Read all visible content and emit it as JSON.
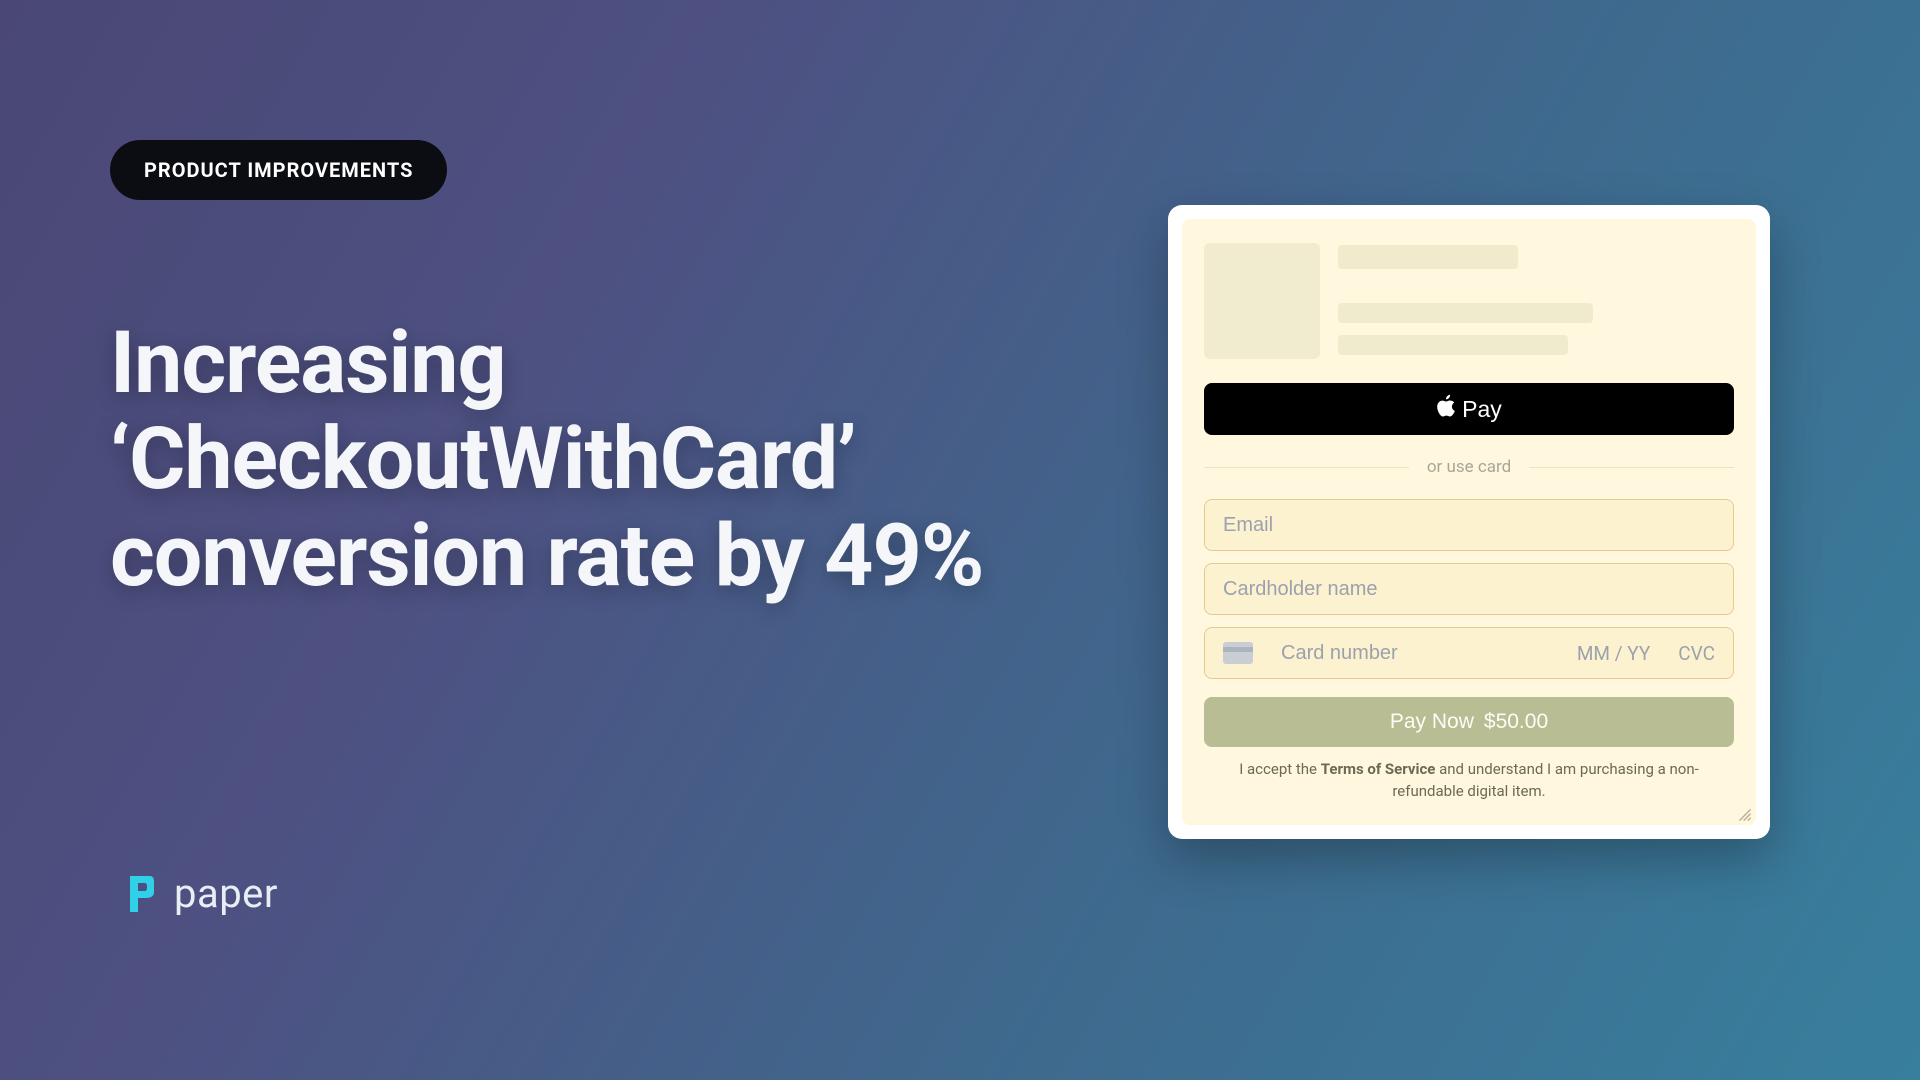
{
  "badge": {
    "label": "PRODUCT IMPROVEMENTS"
  },
  "headline": "Increasing ‘CheckoutWithCard’ conversion rate by 49%",
  "brand": {
    "name": "paper"
  },
  "checkout": {
    "apple_pay_label": "Pay",
    "divider_text": "or use card",
    "email_placeholder": "Email",
    "name_placeholder": "Cardholder name",
    "card_placeholder": "Card number",
    "expiry_placeholder": "MM / YY",
    "cvc_placeholder": "CVC",
    "pay_button_label": "Pay Now",
    "pay_button_amount": "$50.00",
    "disclaimer_prefix": "I accept the ",
    "disclaimer_tos": "Terms of Service",
    "disclaimer_suffix": " and understand I am purchasing a non-refundable digital item."
  }
}
